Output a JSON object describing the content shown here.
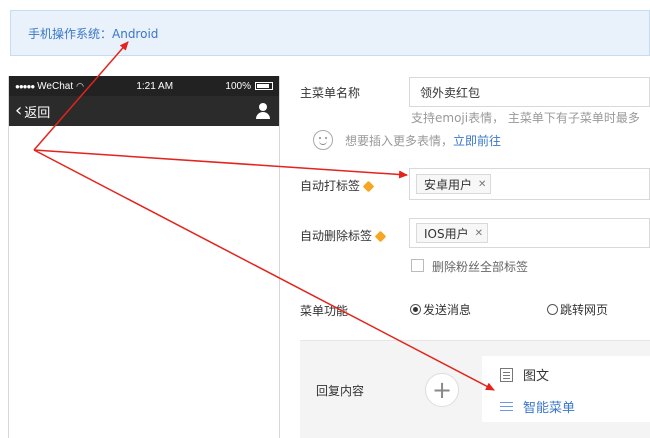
{
  "banner": {
    "text": "手机操作系统：Android"
  },
  "phone": {
    "carrier": "WeChat",
    "signal": "●●●●●",
    "time": "1:21 AM",
    "battery": "100%",
    "back_label": "返回"
  },
  "form": {
    "menu_name": {
      "label": "主菜单名称",
      "value": "领外卖红包",
      "hint": "支持emoji表情， 主菜单下有子菜单时最多",
      "emoji_hint": "想要插入更多表情，",
      "emoji_link": "立即前往"
    },
    "auto_tag": {
      "label": "自动打标签",
      "tag": "安卓用户"
    },
    "auto_untag": {
      "label": "自动删除标签",
      "tag": "IOS用户",
      "checkbox_label": "删除粉丝全部标签"
    },
    "menu_function": {
      "label": "菜单功能",
      "options": [
        "发送消息",
        "跳转网页"
      ],
      "selected": "发送消息"
    },
    "reply": {
      "label": "回复内容",
      "menu_items": [
        "图文",
        "智能菜单"
      ]
    }
  },
  "colors": {
    "arrow": "#e3231c",
    "link": "#3a77c9",
    "banner_bg": "#e9f1fb"
  }
}
